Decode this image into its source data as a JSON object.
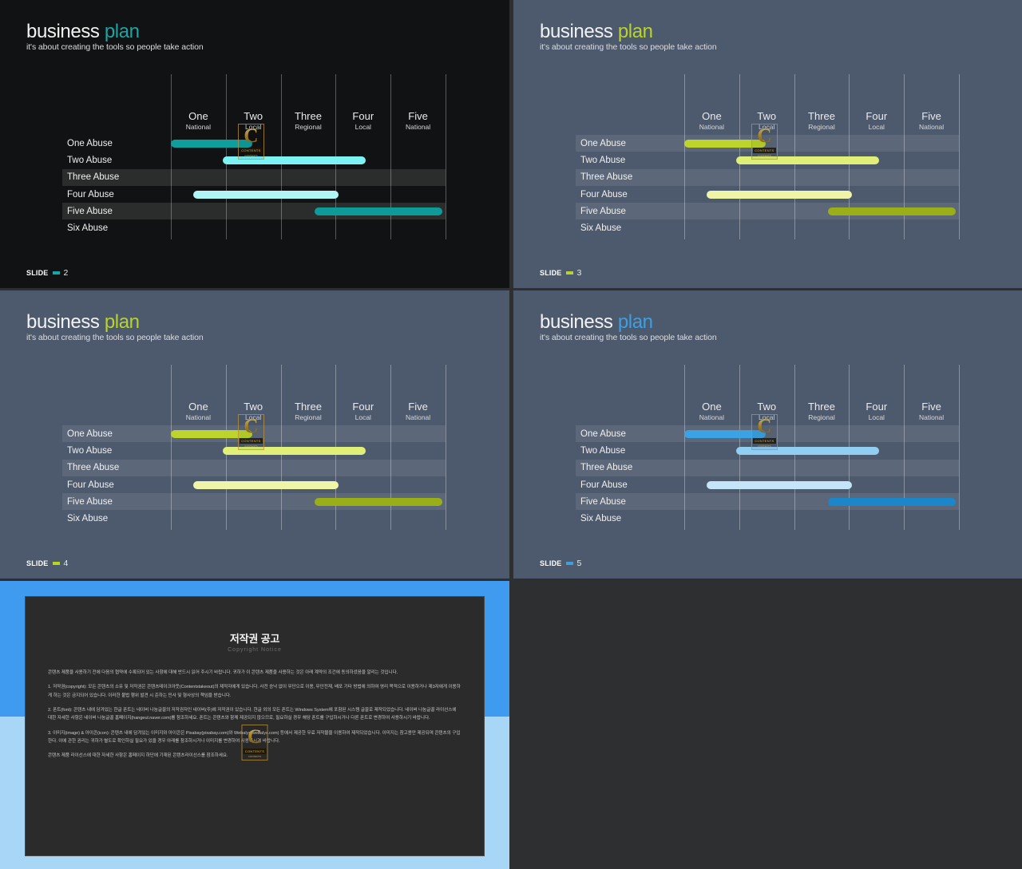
{
  "canvas": {
    "background": "#2e2f31"
  },
  "common": {
    "title_main": "business",
    "title_accent": "plan",
    "subtitle": "it's about creating the tools so people take action",
    "slide_label": "SLIDE",
    "watermark": {
      "glyph": "C",
      "bar_text": "CONTENTS",
      "sub_text": "CONTENTS"
    },
    "columns": [
      {
        "big": "One",
        "small": "National"
      },
      {
        "big": "Two",
        "small": "Local"
      },
      {
        "big": "Three",
        "small": "Regional"
      },
      {
        "big": "Four",
        "small": "Local"
      },
      {
        "big": "Five",
        "small": "National"
      }
    ],
    "rows": [
      "One Abuse",
      "Two Abuse",
      "Three Abuse",
      "Four Abuse",
      "Five Abuse",
      "Six Abuse"
    ]
  },
  "chart_data": {
    "type": "bar",
    "title": "business plan",
    "subtitle": "it's about creating the tools so people take action",
    "orientation": "horizontal-gantt",
    "categories": [
      "One Abuse",
      "Two Abuse",
      "Three Abuse",
      "Four Abuse",
      "Five Abuse",
      "Six Abuse"
    ],
    "xlabel": "",
    "ylabel": "",
    "x_tick_labels": [
      "One / National",
      "Two / Local",
      "Three / Regional",
      "Four / Local",
      "Five / National"
    ],
    "xlim": [
      0,
      5
    ],
    "grid": true,
    "legend": "none",
    "bars": [
      {
        "category": "One Abuse",
        "start": 0.0,
        "end": 1.48,
        "shade": "dark"
      },
      {
        "category": "Two Abuse",
        "start": 0.95,
        "end": 3.55,
        "shade": "light"
      },
      {
        "category": "Three Abuse",
        "start": null,
        "end": null,
        "shade": "none"
      },
      {
        "category": "Four Abuse",
        "start": 0.41,
        "end": 3.05,
        "shade": "pale"
      },
      {
        "category": "Five Abuse",
        "start": 2.61,
        "end": 4.94,
        "shade": "deep"
      },
      {
        "category": "Six Abuse",
        "start": null,
        "end": null,
        "shade": "none"
      }
    ],
    "highlighted_rows": [
      "One Abuse",
      "Three Abuse",
      "Five Abuse"
    ]
  },
  "slides": [
    {
      "id": "slide-2",
      "theme": "dark",
      "number": "2",
      "accent_color": "#1aa5a5",
      "background": "#111213",
      "highlighted_rows": [
        2,
        4
      ],
      "bar_colors": [
        "#0f9e9e",
        "#7df2f2",
        "",
        "#b0f5f5",
        "#0f9a9a"
      ]
    },
    {
      "id": "slide-3",
      "theme": "slate",
      "number": "3",
      "accent_color": "#b8d42a",
      "background": "#4d5a6e",
      "highlighted_rows": [
        0,
        2,
        4
      ],
      "bar_colors": [
        "#bcd42b",
        "#e0ef77",
        "",
        "#eef5a8",
        "#9aae18"
      ]
    },
    {
      "id": "slide-4",
      "theme": "slate",
      "number": "4",
      "accent_color": "#b8d42a",
      "background": "#4d5a6e",
      "highlighted_rows": [
        0,
        2,
        4
      ],
      "bar_colors": [
        "#bcd42b",
        "#e0ef77",
        "",
        "#eef5a8",
        "#9aae18"
      ]
    },
    {
      "id": "slide-5",
      "theme": "slate",
      "number": "5",
      "accent_color": "#3d9fe0",
      "background": "#4d5a6e",
      "highlighted_rows": [
        0,
        2,
        4
      ],
      "bar_colors": [
        "#3ba2e4",
        "#92cdf2",
        "",
        "#c6e4f8",
        "#1b86c9"
      ]
    }
  ],
  "copyright_slide": {
    "border_top_color": "#3f9bf0",
    "border_bottom_color": "#a8d6f7",
    "title_kr": "저작권 공고",
    "title_en": "Copyright Notice",
    "paragraphs": [
      "콘텐츠 제품을 사용하기 전에 다음의 협약에 수록되어 있는 사항에 대해 반드시 읽어 주시기 바랍니다. 귀하가 이 콘텐츠 제품을 사용하는 것은 아래 계약의 조건에 동의하셨음을 알리는 것입니다.",
      "1. 저작권(copyright): 모든 콘텐츠의 소유 및 저작권은 콘텐츠테이크아웃(Contentstakeout)의 제작자에게 있습니다. 사전 승낙 없이 무단으로 이용, 무단전재, 배포 기타 방법에 의하여 영리 목적으로 이용하거나 제3자에게 이용하게 하는 것은 금지되어 있습니다. 이러한 불법 행위 발견 시 준하는 민사 및 형사상의 책임을 받습니다.",
      "2. 폰트(font): 콘텐츠 내에 담겨있는 한글 폰트는 네이버 나눔글꼴의 저작권자인 네이버(주)에 저작권이 있습니다. 한글 외의 모든 폰트는 Windows System에 포함된 시스템 글꼴로 제작되었습니다. 네이버 나눔글꼴 라이선스에 대한 자세한 사항은 네이버 나눔글꼴 홈페이지(hangeul.naver.com)를 참조하세요. 폰트는 콘텐츠와 함께 제공되지 않으므로, 필요하실 경우 해당 폰트를 구입하시거나 다른 폰트로 변경하여 사용하시기 바랍니다.",
      "3. 이미지(image) & 아이콘(icon): 콘텐츠 내에 담겨있는 이미지와 아이콘은 Pixabay(pixabay.com)와 Webalys(webalys.com) 등에서 제공한 무료 저작물을 이용하여 제작되었습니다. 이미지는 참고용만 제공되며 콘텐츠의 구입한다. 이에 관한 권리는 귀하가 별도로 확인하실 필요가 있을 경우 아래를 참조하시거나 이미지를 변경하여 사용하시기 바랍니다.",
      "콘텐츠 제품 라이선스에 대한 자세한 사항은 홈페이지 하단에 기재된 콘텐츠라이선스를 참조하세요."
    ]
  }
}
